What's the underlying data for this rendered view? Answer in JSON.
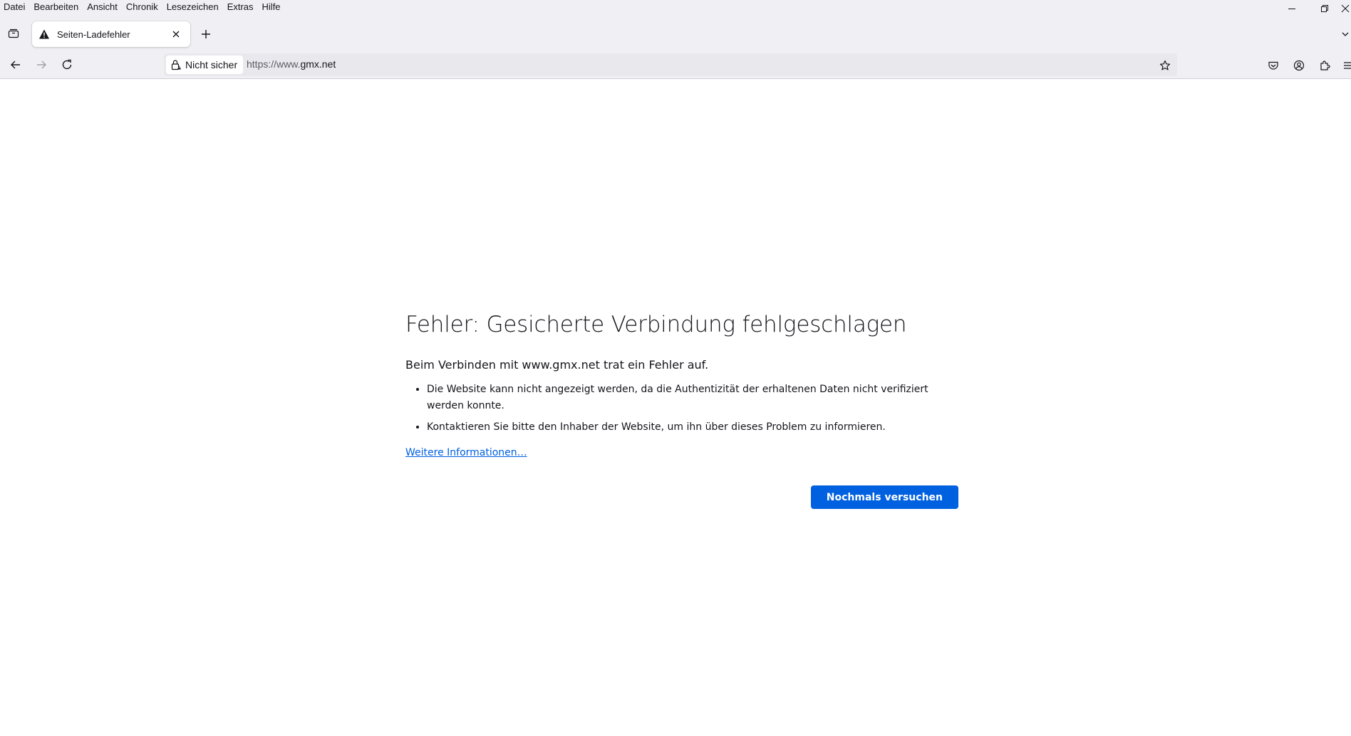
{
  "menubar": {
    "items": [
      "Datei",
      "Bearbeiten",
      "Ansicht",
      "Chronik",
      "Lesezeichen",
      "Extras",
      "Hilfe"
    ]
  },
  "window_controls": [
    "minimize-icon",
    "restore-icon",
    "close-icon"
  ],
  "tabs": [
    {
      "title": "Seiten-Ladefehler",
      "icon": "warning-icon",
      "active": true
    }
  ],
  "urlbar": {
    "identity_label": "Nicht sicher",
    "url_prefix": "https://www.",
    "url_host": "gmx.net"
  },
  "toolbar_icons": [
    "pocket-icon",
    "account-icon",
    "extensions-icon",
    "menu-icon"
  ],
  "error_page": {
    "title": "Fehler: Gesicherte Verbindung fehlgeschlagen",
    "intro": "Beim Verbinden mit www.gmx.net trat ein Fehler auf.",
    "bullets": [
      "Die Website kann nicht angezeigt werden, da die Authentizität der erhaltenen Daten nicht verifiziert werden konnte.",
      "Kontaktieren Sie bitte den Inhaber der Website, um ihn über dieses Problem zu informieren."
    ],
    "learn_more": "Weitere Informationen…",
    "try_again": "Nochmals versuchen"
  },
  "colors": {
    "chrome_bg": "#f0f0f4",
    "accent": "#0061e0",
    "text": "#15141a"
  }
}
